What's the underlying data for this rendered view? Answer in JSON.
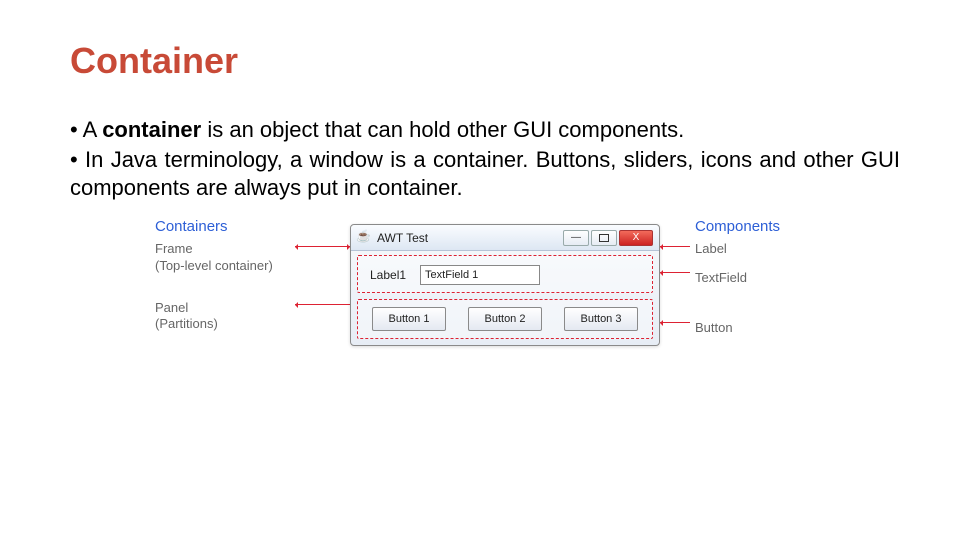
{
  "title": "Container",
  "bullets": {
    "b1_pre": "A ",
    "b1_bold": "container",
    "b1_post": " is an object that can hold other GUI components.",
    "b2": "In Java terminology, a window is a container. Buttons, sliders, icons and other GUI components are always put in container."
  },
  "diagram": {
    "left_header": "Containers",
    "left_frame": "Frame",
    "left_frame_sub": "(Top-level container)",
    "left_panel": "Panel",
    "left_panel_sub": "(Partitions)",
    "right_header": "Components",
    "right_label": "Label",
    "right_textfield": "TextField",
    "right_button": "Button",
    "window_title": "AWT Test",
    "min_glyph": "—",
    "close_glyph": "X",
    "label1": "Label1",
    "textfield_value": "TextField 1",
    "btn1": "Button 1",
    "btn2": "Button 2",
    "btn3": "Button 3"
  }
}
